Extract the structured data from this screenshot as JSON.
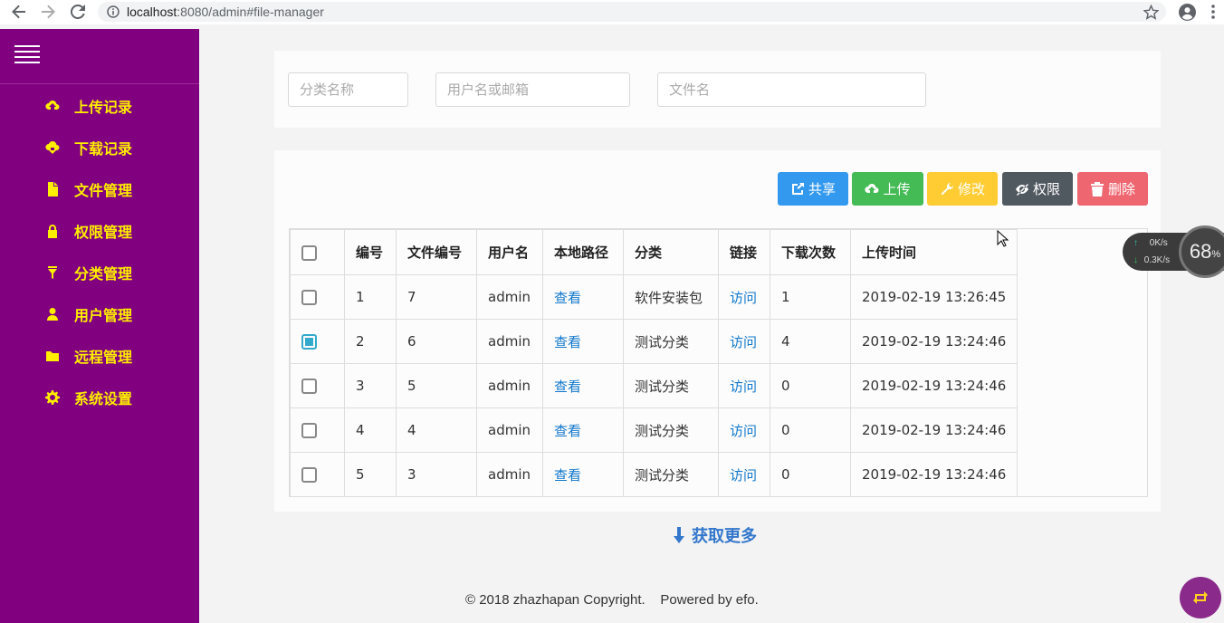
{
  "browser": {
    "url_host": "localhost",
    "url_path": ":8080/admin#file-manager"
  },
  "sidebar": {
    "items": [
      {
        "label": "上传记录",
        "icon": "cloud-upload-icon"
      },
      {
        "label": "下载记录",
        "icon": "cloud-download-icon"
      },
      {
        "label": "文件管理",
        "icon": "file-icon"
      },
      {
        "label": "权限管理",
        "icon": "lock-icon"
      },
      {
        "label": "分类管理",
        "icon": "filter-icon"
      },
      {
        "label": "用户管理",
        "icon": "user-icon"
      },
      {
        "label": "远程管理",
        "icon": "folder-icon"
      },
      {
        "label": "系统设置",
        "icon": "gear-icon"
      }
    ]
  },
  "filters": {
    "category_placeholder": "分类名称",
    "user_placeholder": "用户名或邮箱",
    "filename_placeholder": "文件名"
  },
  "toolbar": {
    "share": "共享",
    "upload": "上传",
    "edit": "修改",
    "permission": "权限",
    "delete": "删除"
  },
  "table": {
    "headers": [
      "编号",
      "文件编号",
      "用户名",
      "本地路径",
      "分类",
      "链接",
      "下载次数",
      "上传时间"
    ],
    "rows": [
      {
        "checked": false,
        "id": "1",
        "file_id": "7",
        "user": "admin",
        "path": "查看",
        "category": "软件安装包",
        "link": "访问",
        "downloads": "1",
        "time": "2019-02-19 13:26:45"
      },
      {
        "checked": true,
        "id": "2",
        "file_id": "6",
        "user": "admin",
        "path": "查看",
        "category": "测试分类",
        "link": "访问",
        "downloads": "4",
        "time": "2019-02-19 13:24:46"
      },
      {
        "checked": false,
        "id": "3",
        "file_id": "5",
        "user": "admin",
        "path": "查看",
        "category": "测试分类",
        "link": "访问",
        "downloads": "0",
        "time": "2019-02-19 13:24:46"
      },
      {
        "checked": false,
        "id": "4",
        "file_id": "4",
        "user": "admin",
        "path": "查看",
        "category": "测试分类",
        "link": "访问",
        "downloads": "0",
        "time": "2019-02-19 13:24:46"
      },
      {
        "checked": false,
        "id": "5",
        "file_id": "3",
        "user": "admin",
        "path": "查看",
        "category": "测试分类",
        "link": "访问",
        "downloads": "0",
        "time": "2019-02-19 13:24:46"
      }
    ]
  },
  "load_more": "获取更多",
  "footer": "© 2018 zhazhapan Copyright.    Powered by efo.",
  "net_widget": {
    "up": "0K/s",
    "down": "0.3K/s",
    "percent": "68",
    "percent_unit": "%"
  }
}
